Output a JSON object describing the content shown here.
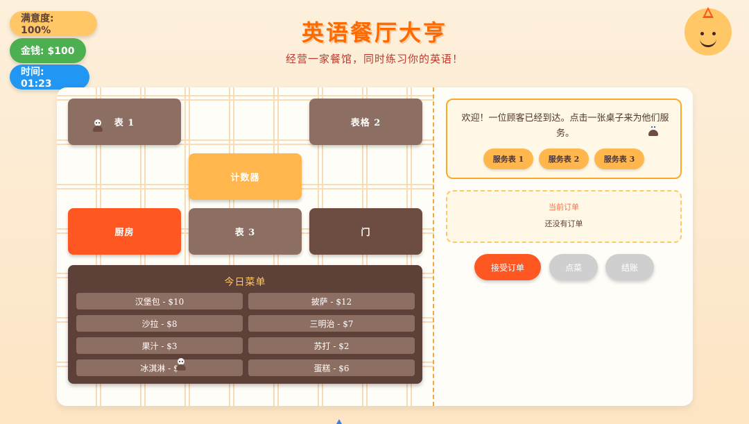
{
  "stats": {
    "satisfaction": "满意度: 100%",
    "money": "金钱: $100",
    "time": "时间: 01:23"
  },
  "header": {
    "title": "英语餐厅大亨",
    "subtitle": "经营一家餐馆，同时练习你的英语！"
  },
  "floor": {
    "table1": "表 1",
    "table2": "表格 2",
    "counter": "计数器",
    "kitchen": "厨房",
    "table3": "表 3",
    "door": "门"
  },
  "menu": {
    "title": "今日菜单",
    "items": [
      {
        "label": "汉堡包 - $10"
      },
      {
        "label": "披萨 - $12"
      },
      {
        "label": "沙拉 - $8"
      },
      {
        "label": "三明治 - $7"
      },
      {
        "label": "果汁 - $3"
      },
      {
        "label": "苏打 - $2"
      },
      {
        "label": "冰淇淋 - $"
      },
      {
        "label": "蛋糕 - $6"
      }
    ]
  },
  "welcome": {
    "text": "欢迎！一位顾客已经到达。点击一张桌子来为他们服务。",
    "buttons": [
      "服务表 1",
      "服务表 2",
      "服务表 3"
    ]
  },
  "order": {
    "title": "当前订单",
    "empty": "还没有订单"
  },
  "actions": {
    "accept": "接受订单",
    "order": "点菜",
    "bill": "结账"
  },
  "colors": {
    "accent": "#ff5722",
    "wood": "#8d6e63",
    "gold": "#ffb74d",
    "dark": "#5d4037"
  }
}
